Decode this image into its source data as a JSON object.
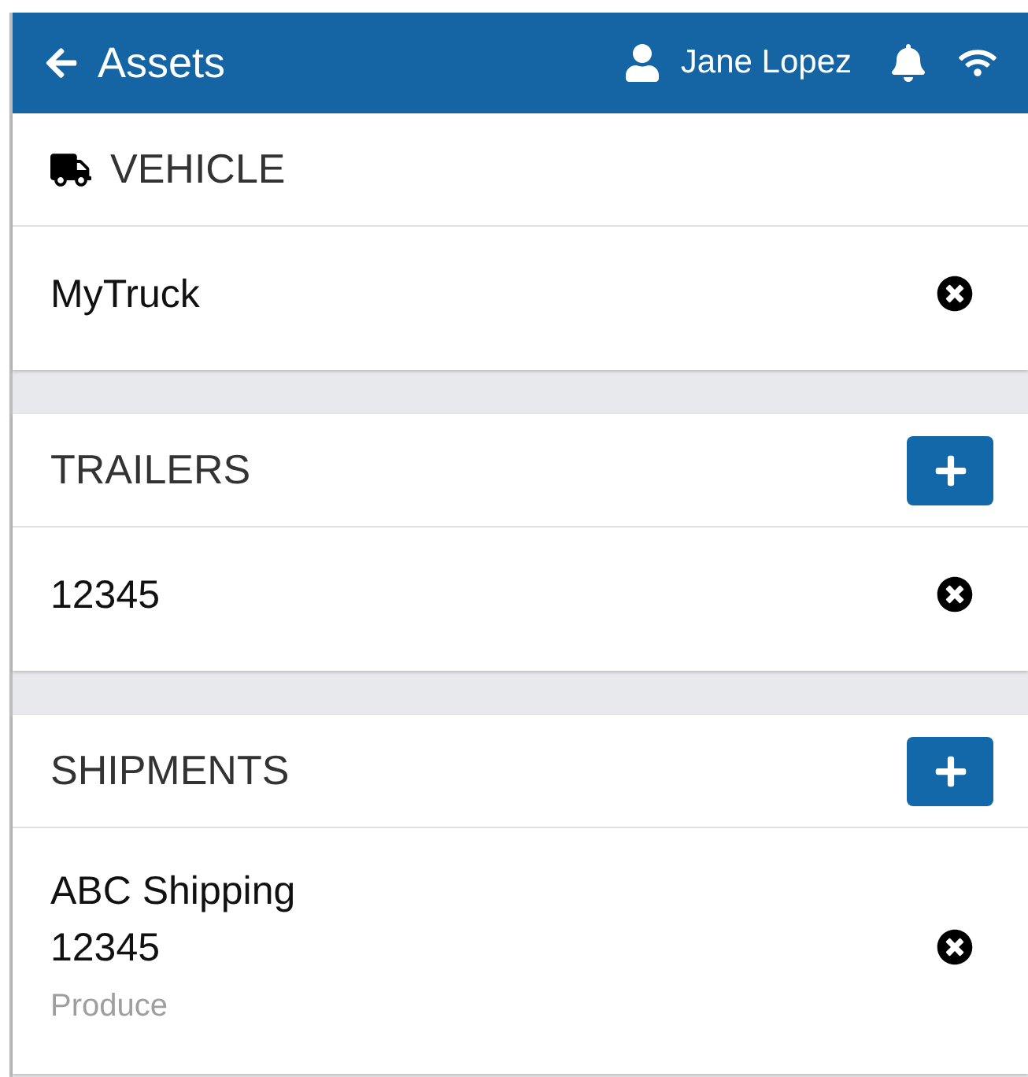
{
  "header": {
    "title": "Assets",
    "user": "Jane Lopez"
  },
  "sections": [
    {
      "kind": "vehicle",
      "title": "VEHICLE",
      "addable": false,
      "items": [
        {
          "lines": [
            "MyTruck"
          ]
        }
      ]
    },
    {
      "kind": "list",
      "title": "TRAILERS",
      "addable": true,
      "items": [
        {
          "lines": [
            "12345"
          ]
        }
      ]
    },
    {
      "kind": "list",
      "title": "SHIPMENTS",
      "addable": true,
      "items": [
        {
          "lines": [
            "ABC Shipping",
            "12345"
          ],
          "note": "Produce"
        }
      ]
    }
  ]
}
